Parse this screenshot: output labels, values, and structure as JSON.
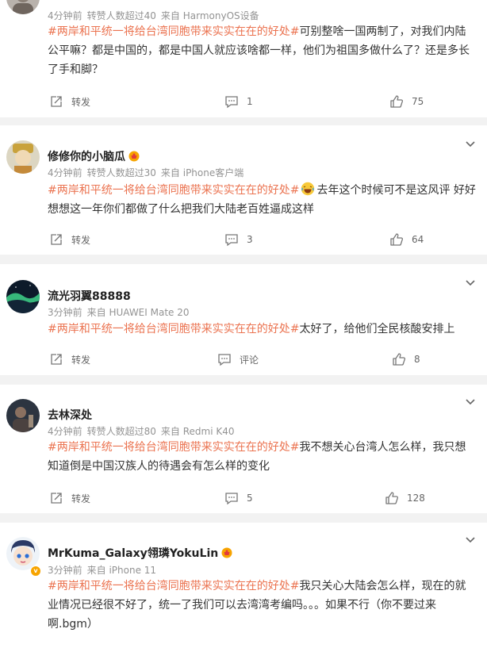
{
  "comments": [
    {
      "username": "",
      "time": "4分钟前",
      "likes_note": "转赞人数超过40",
      "source": "来自 HarmonyOS设备",
      "topic": "#两岸和平统一将给台湾同胞带来实实在在的好处#",
      "text": "可别整啥一国两制了，对我们内陆公平嘛？都是中国的，都是中国人就应该啥都一样，他们为祖国多做什么了？还是多长了手和脚？",
      "repost_label": "转发",
      "comment_count": "1",
      "like_count": "75"
    },
    {
      "username": "修修你的小脑瓜",
      "time": "4分钟前",
      "likes_note": "转赞人数超过30",
      "source": "来自 iPhone客户端",
      "topic": "#两岸和平统一将给台湾同胞带来实实在在的好处#",
      "text": "去年这个时候可不是这风评 好好想想这一年你们都做了什么把我们大陆老百姓逼成这样",
      "repost_label": "转发",
      "comment_count": "3",
      "like_count": "64"
    },
    {
      "username": "流光羽翼88888",
      "time": "3分钟前",
      "source": "来自 HUAWEI Mate 20",
      "topic": "#两岸和平统一将给台湾同胞带来实实在在的好处#",
      "text": "太好了，给他们全民核酸安排上",
      "repost_label": "转发",
      "comment_label": "评论",
      "like_count": "8"
    },
    {
      "username": "去林深处",
      "time": "4分钟前",
      "likes_note": "转赞人数超过80",
      "source": "来自 Redmi K40",
      "topic": "#两岸和平统一将给台湾同胞带来实实在在的好处#",
      "text": "我不想关心台湾人怎么样，我只想知道倒是中国汉族人的待遇会有怎么样的变化",
      "repost_label": "转发",
      "comment_count": "5",
      "like_count": "128"
    },
    {
      "username": "MrKuma_Galaxy翎璘YokuLin",
      "time": "3分钟前",
      "source": "来自 iPhone 11",
      "topic": "#两岸和平统一将给台湾同胞带来实实在在的好处#",
      "text": "我只关心大陆会怎么样，现在的就业情况已经很不好了，统一了我们可以去湾湾考编吗。。。如果不行（你不要过来啊.bgm）"
    }
  ],
  "colors": {
    "topic": "#eb7350",
    "meta": "#939393",
    "background": "#f2f2f2",
    "vip": "#f7a400"
  }
}
